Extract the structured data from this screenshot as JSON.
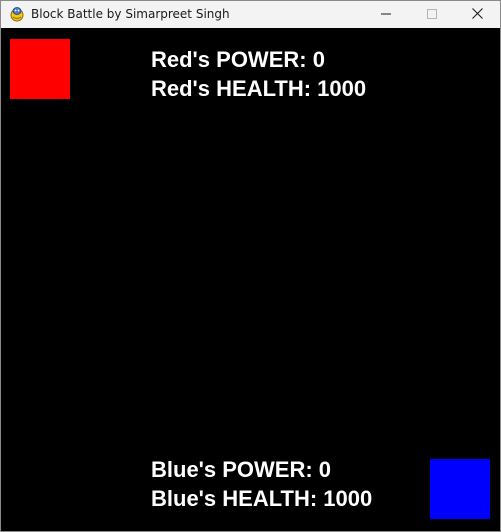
{
  "window": {
    "title": "Block Battle by Simarpreet Singh",
    "icon": "pygame-snake-icon",
    "controls": {
      "minimize": "minimize-icon",
      "maximize": "maximize-icon",
      "close": "close-icon"
    }
  },
  "game": {
    "background_color": "#000000",
    "red": {
      "color": "#ff0000",
      "power_text": "Red's POWER: 0",
      "health_text": "Red's HEALTH: 1000",
      "power": 0,
      "health": 1000
    },
    "blue": {
      "color": "#0000ff",
      "power_text": "Blue's POWER: 0",
      "health_text": "Blue's HEALTH: 1000",
      "power": 0,
      "health": 1000
    }
  }
}
